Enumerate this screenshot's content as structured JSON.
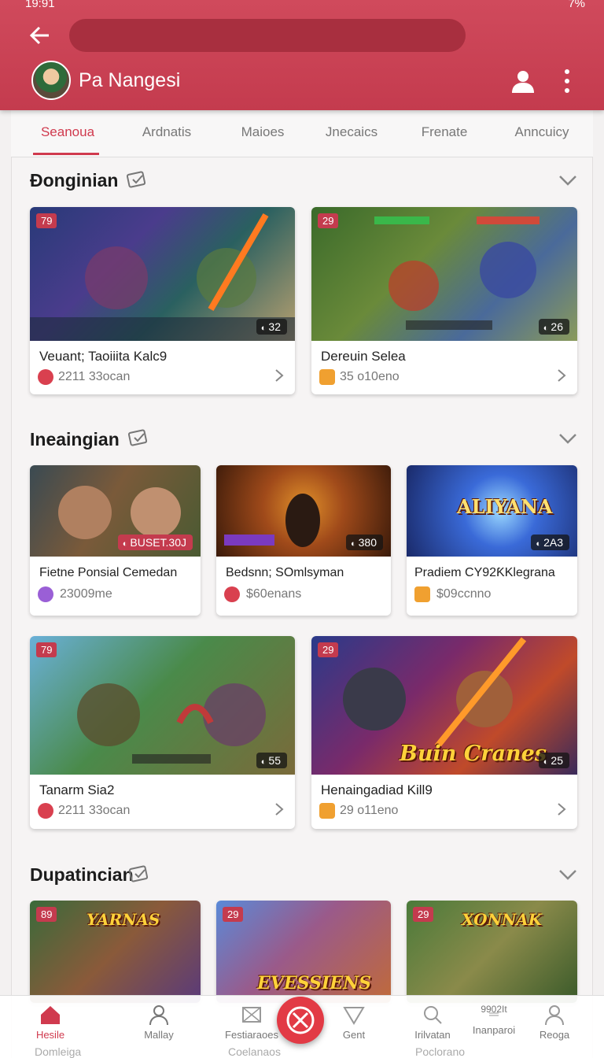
{
  "status": {
    "time": "19:91",
    "battery": "7%"
  },
  "header": {
    "app_name": "Pa Nangesi"
  },
  "tabs": [
    {
      "label": "Seanoua",
      "active": true
    },
    {
      "label": "Ardnatis",
      "active": false
    },
    {
      "label": "Maioes",
      "active": false
    },
    {
      "label": "Jnecaics",
      "active": false
    },
    {
      "label": "Frenate",
      "active": false
    },
    {
      "label": "Anncuicy",
      "active": false
    }
  ],
  "sections": [
    {
      "title": "Đonginian",
      "cards": [
        {
          "badge": "79",
          "count": "32",
          "title": "Veuant; Taoiiita Kalc9",
          "meta": "2211 33ocan",
          "meta_icon": "heart-check-icon",
          "meta_color": "#d9404f",
          "art_text": ""
        },
        {
          "badge": "29",
          "count": "26",
          "title": "Dereuin Selea",
          "meta": "35 o10eno",
          "meta_icon": "hex-badge-icon",
          "meta_color": "#f0a030",
          "art_text": ""
        }
      ]
    },
    {
      "title": "Ineaingian",
      "cards": [
        {
          "badge": "",
          "count": "BUSET.30J",
          "title": "Fietne Ponsial Cemedan",
          "meta": "23009me",
          "meta_icon": "heart-check-icon",
          "meta_color": "#9a5fd6",
          "art_text": ""
        },
        {
          "badge": "",
          "count": "380",
          "title": "Bedsnn; SOmlsyman",
          "meta": "$60enans",
          "meta_icon": "flower-icon",
          "meta_color": "#d9404f",
          "art_text": ""
        },
        {
          "badge": "",
          "count": "2A3",
          "title": "Pradiem CY92ƘKlegrana",
          "meta": "$09ccnno",
          "meta_icon": "hex-badge-icon",
          "meta_color": "#f0a030",
          "art_text": "ALIYANA"
        },
        {
          "badge": "79",
          "count": "55",
          "title": "Tanarm Sia2",
          "meta": "2211 33ocan",
          "meta_icon": "heart-check-icon",
          "meta_color": "#d9404f",
          "art_text": ""
        },
        {
          "badge": "29",
          "count": "25",
          "title": "Henaingadiad Kill9",
          "meta": "29 o11eno",
          "meta_icon": "hex-badge-icon",
          "meta_color": "#f0a030",
          "art_text": "Buin Cranes"
        }
      ]
    },
    {
      "title": "Dupatincian",
      "cards": [
        {
          "badge": "89",
          "art_text": "YARNAS"
        },
        {
          "badge": "29",
          "art_text": "EVESSIENS"
        },
        {
          "badge": "29",
          "art_text": "XONNAK"
        }
      ]
    }
  ],
  "bottom_nav": [
    {
      "label": "Hesile",
      "icon": "home-icon",
      "active": true
    },
    {
      "label": "Mallay",
      "icon": "person-icon",
      "active": false
    },
    {
      "label": "Festiaraoes",
      "icon": "mail-icon",
      "active": false
    },
    {
      "label": "Gent",
      "icon": "send-icon",
      "active": false
    },
    {
      "label": "Irilvatan",
      "icon": "search-icon",
      "active": false
    },
    {
      "label": "Inanparoi",
      "icon": "list-icon",
      "active": false,
      "sublabel": "9902It"
    },
    {
      "label": "Reoga",
      "icon": "person-icon",
      "active": false
    }
  ],
  "peek": [
    "Domleiga",
    "Coelanaos",
    "Poclorano"
  ],
  "colors": {
    "brand": "#c43b4e",
    "accent": "#d03a4e",
    "fab": "#e23a45"
  }
}
